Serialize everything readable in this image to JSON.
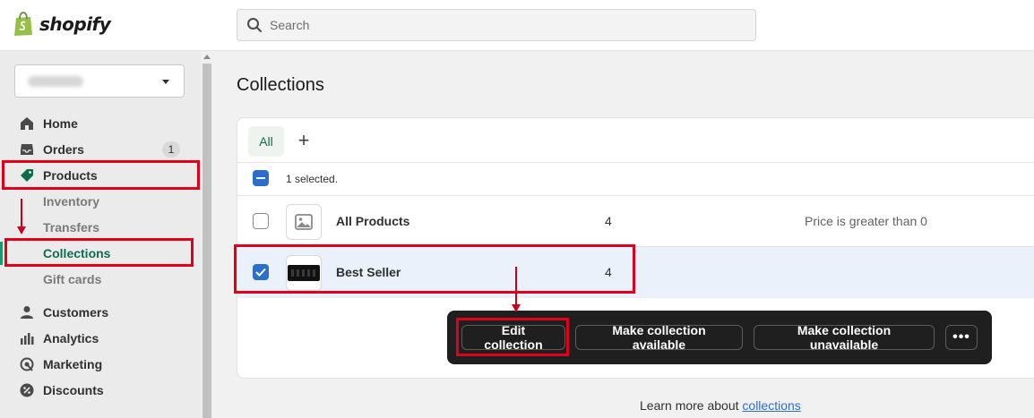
{
  "brand": {
    "name": "shopify",
    "accent": "#1a9b6c",
    "brand_green": "#95bf47"
  },
  "search": {
    "placeholder": "Search"
  },
  "store_selector": {
    "value": ""
  },
  "nav": {
    "home": "Home",
    "orders": "Orders",
    "orders_badge": "1",
    "products": "Products",
    "inventory": "Inventory",
    "transfers": "Transfers",
    "collections": "Collections",
    "gift_cards": "Gift cards",
    "customers": "Customers",
    "analytics": "Analytics",
    "marketing": "Marketing",
    "discounts": "Discounts"
  },
  "page": {
    "title": "Collections"
  },
  "tabs": {
    "all": "All",
    "add": "+"
  },
  "bulk": {
    "selected_text": "1 selected."
  },
  "rows": [
    {
      "name": "All Products",
      "count": "4",
      "condition": "Price is greater than 0",
      "selected": false
    },
    {
      "name": "Best Seller",
      "count": "4",
      "condition": "",
      "selected": true
    }
  ],
  "actions": {
    "edit": "Edit collection",
    "make_available": "Make collection available",
    "make_unavailable": "Make collection unavailable",
    "more": "•••"
  },
  "footer": {
    "learn_prefix": "Learn more about ",
    "learn_link": "collections"
  },
  "colors": {
    "highlight": "#e0001a",
    "selection": "#2c6ecb",
    "action_bar": "#1f1f1f"
  }
}
